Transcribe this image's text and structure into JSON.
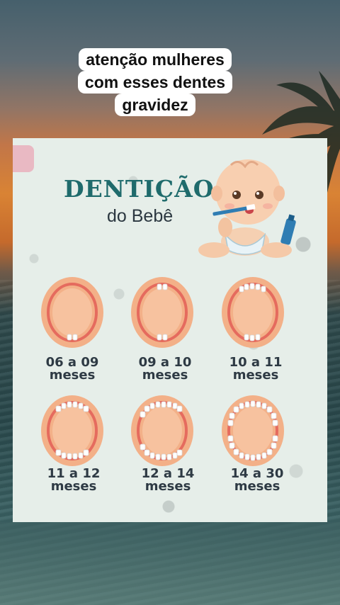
{
  "caption": {
    "lines": [
      "atenção mulheres",
      "com esses dentes",
      "gravidez"
    ]
  },
  "card": {
    "title": "DENTIÇÃO",
    "subtitle": "do Bebê",
    "stages": [
      {
        "line1": "06 a 09",
        "line2": "meses"
      },
      {
        "line1": "09 a 10",
        "line2": "meses"
      },
      {
        "line1": "10 a 11",
        "line2": "meses"
      },
      {
        "line1": "11 a 12",
        "line2": "meses"
      },
      {
        "line1": "12 a 14",
        "line2": "meses"
      },
      {
        "line1": "14 a 30",
        "line2": "meses"
      }
    ]
  },
  "colors": {
    "title": "#1f6b6c",
    "gum": "#f3b088",
    "gum_line": "#e56b5e",
    "tooth": "#ffffff"
  },
  "icons": [
    "baby-illustration",
    "toothbrush-icon",
    "toothpaste-icon",
    "palm-tree-icon"
  ]
}
